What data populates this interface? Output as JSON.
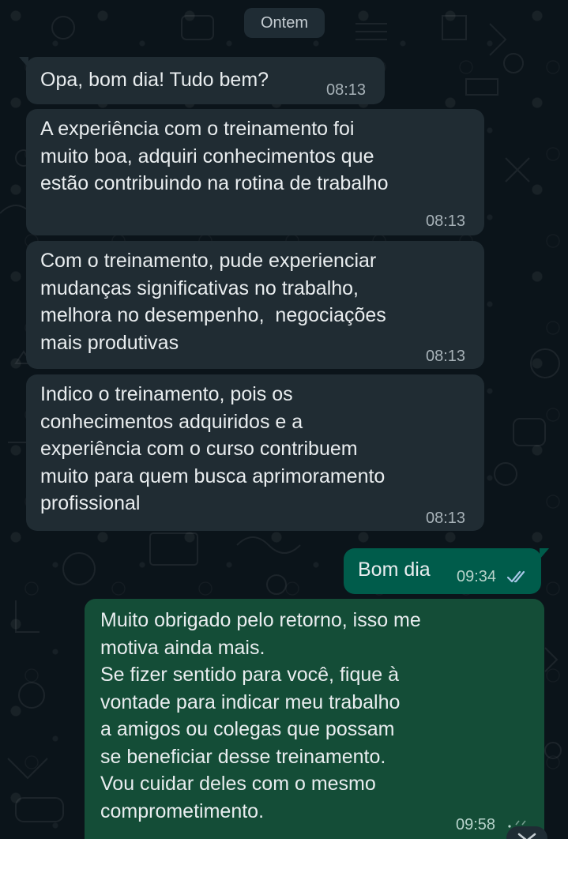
{
  "date_separator": "Ontem",
  "messages": [
    {
      "direction": "incoming",
      "text": "Opa, bom dia! Tudo bem?",
      "time": "08:13"
    },
    {
      "direction": "incoming",
      "text": "A experiência com o treinamento foi\nmuito boa, adquiri conhecimentos que\nestão contribuindo na rotina de trabalho",
      "time": "08:13"
    },
    {
      "direction": "incoming",
      "text": "Com o treinamento, pude experienciar\nmudanças significativas no trabalho,\nmelhora no desempenho,  negociações\nmais produtivas",
      "time": "08:13"
    },
    {
      "direction": "incoming",
      "text": "Indico o treinamento, pois os\nconhecimentos adquiridos e a\nexperiência com o curso contribuem\nmuito para quem busca aprimoramento\nprofissional",
      "time": "08:13"
    },
    {
      "direction": "outgoing",
      "text": "Bom dia",
      "time": "09:34",
      "status": "read"
    },
    {
      "direction": "outgoing",
      "text": "Muito obrigado pelo retorno, isso me\nmotiva ainda mais.\nSe fizer sentido para você, fique à\nvontade para indicar meu trabalho\na amigos ou colegas que possam\nse beneficiar desse treinamento.\nVou cuidar deles com o mesmo\ncomprometimento.",
      "time": "09:58",
      "status": "sent"
    }
  ],
  "icons": {
    "read_receipt": "double-check-icon",
    "scroll_down": "chevron-down-icon"
  },
  "colors": {
    "background": "#0b141a",
    "incoming_bubble": "#202c33",
    "outgoing_bubble": "#005c4b",
    "outgoing_bubble_long": "#144d37",
    "text": "#e9edef",
    "meta": "#a7b2b8"
  }
}
